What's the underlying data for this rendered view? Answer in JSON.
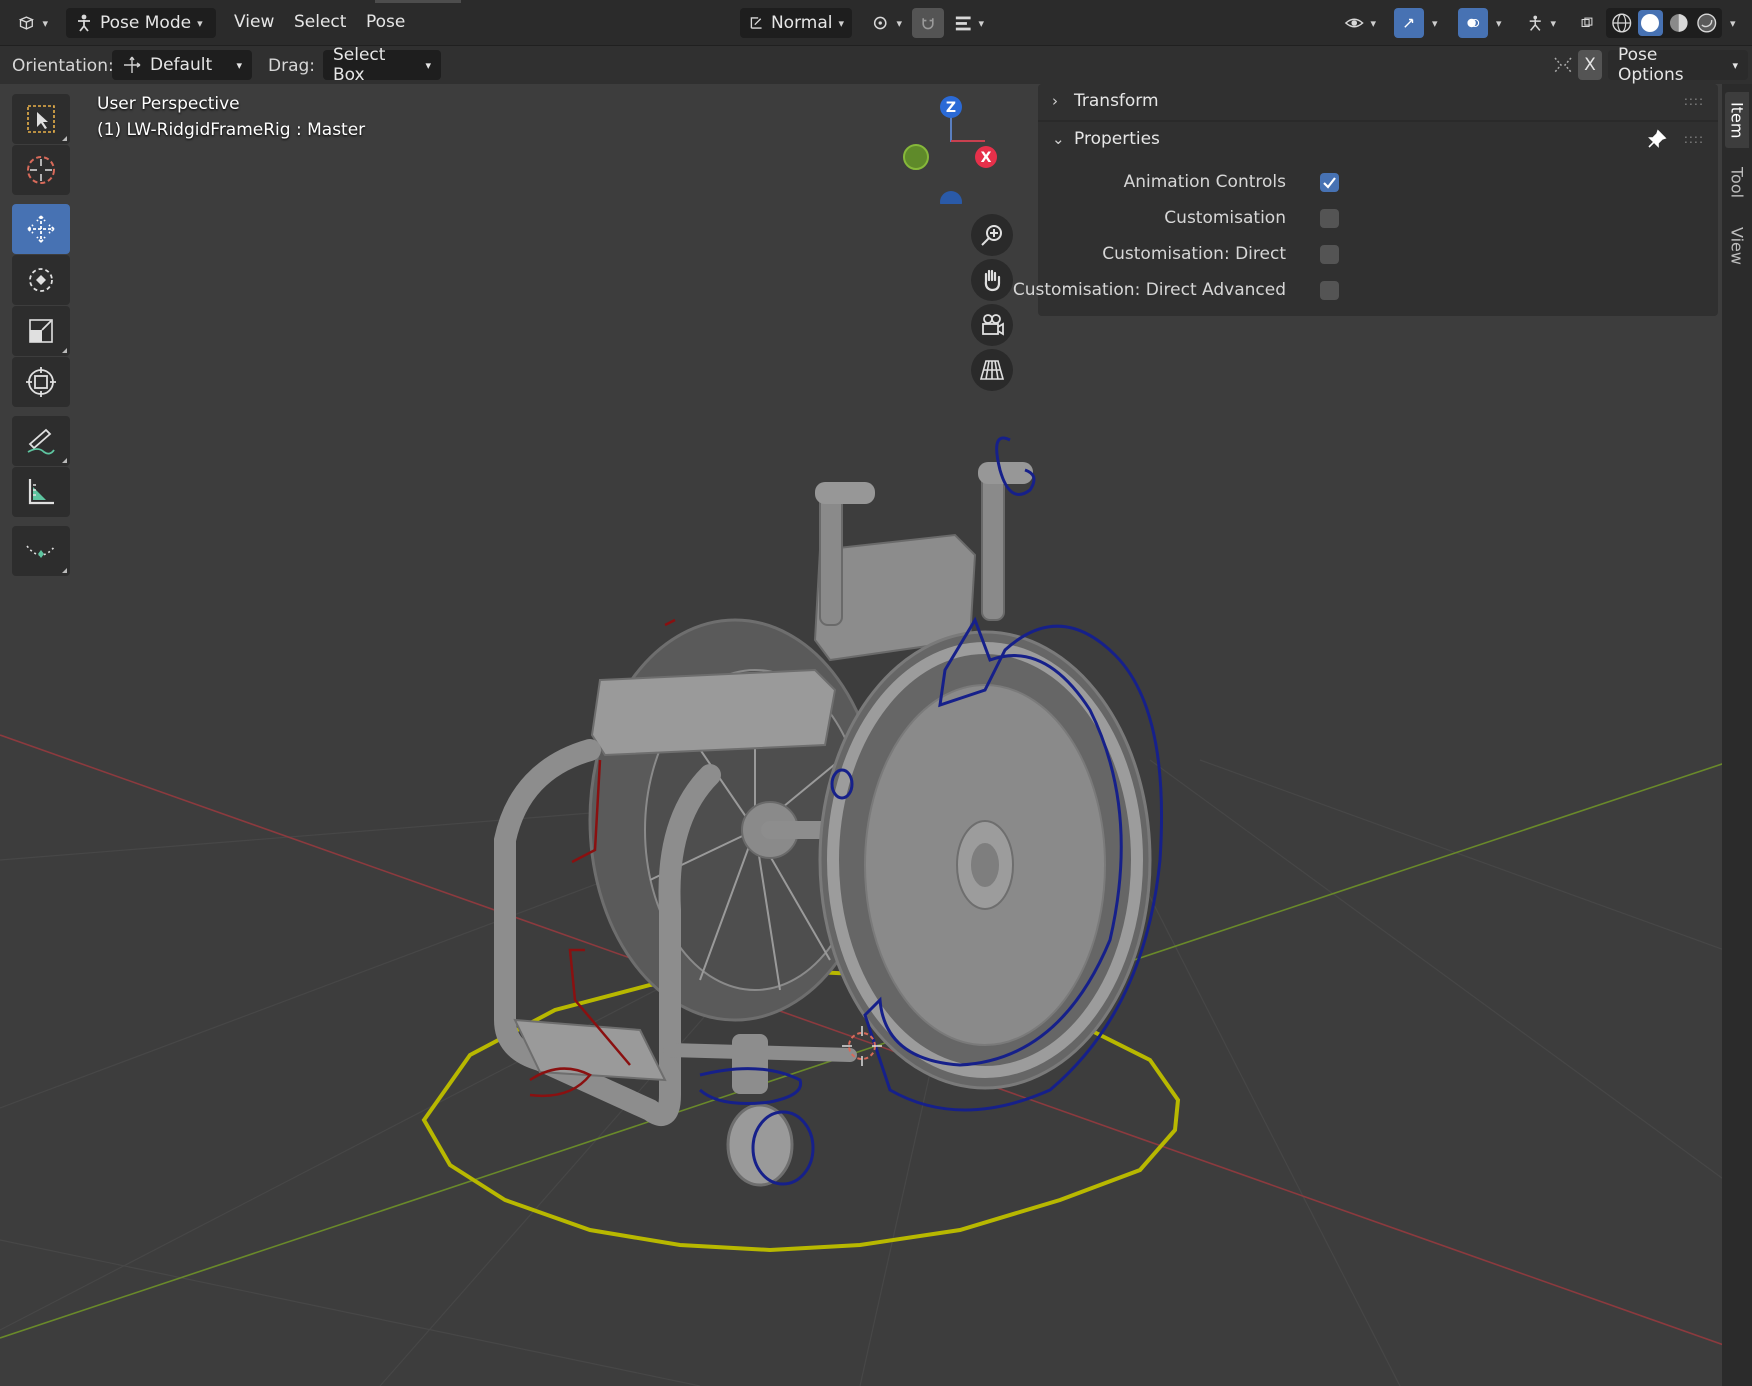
{
  "header": {
    "mode_label": "Pose Mode",
    "menus": [
      "View",
      "Select",
      "Pose"
    ],
    "transform_orientation": "Normal",
    "editor_type_icon": "editor-type-3dview-icon",
    "accent": "#4772b3"
  },
  "toolheader": {
    "orientation_label": "Orientation:",
    "orientation_value": "Default",
    "drag_label": "Drag:",
    "drag_value": "Select Box",
    "x_mirror": "X",
    "pose_options": "Pose Options"
  },
  "viewport": {
    "view_name": "User Perspective",
    "object_info": "(1) LW-RidgidFrameRig : Master",
    "gizmo": {
      "z": "Z",
      "x": "X"
    }
  },
  "toolbar": {
    "tools": [
      "select-box",
      "cursor",
      "move",
      "rotate",
      "scale",
      "transform",
      "annotate",
      "measure",
      "bone-relax"
    ],
    "active": "move"
  },
  "npanel": {
    "sections": {
      "transform": "Transform",
      "properties": "Properties"
    },
    "properties": [
      {
        "label": "Animation Controls",
        "checked": true
      },
      {
        "label": "Customisation",
        "checked": false
      },
      {
        "label": "Customisation: Direct",
        "checked": false
      },
      {
        "label": "Customisation: Direct Advanced",
        "checked": false
      }
    ]
  },
  "sidetabs": [
    "Item",
    "Tool",
    "View"
  ]
}
